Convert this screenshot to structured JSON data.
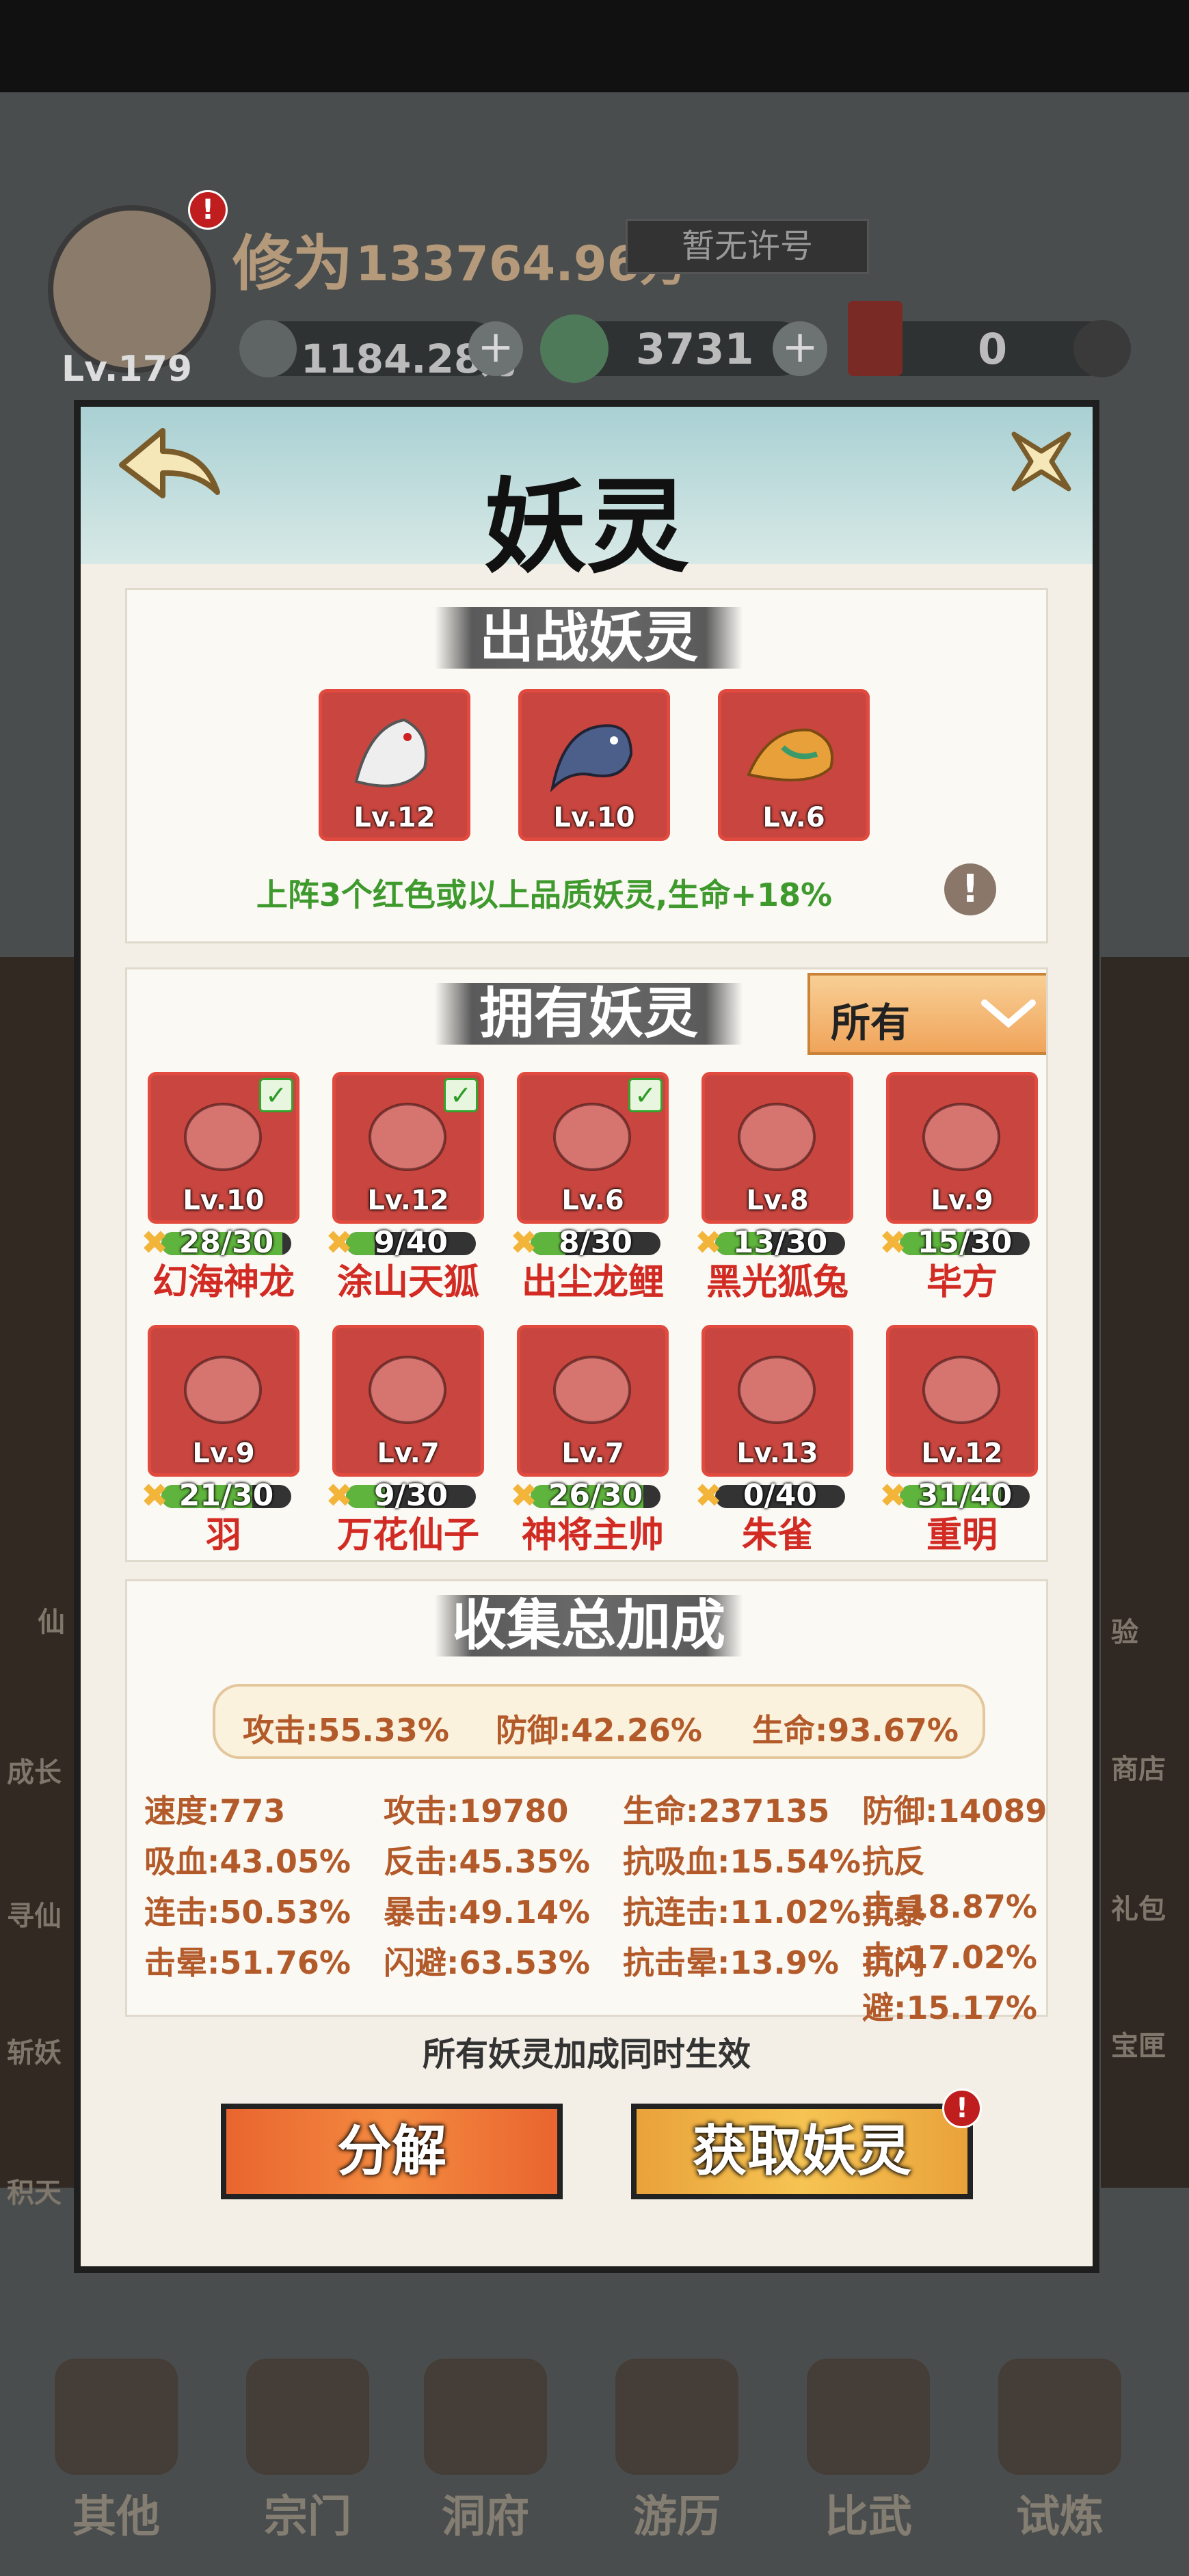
{
  "background": {
    "player": {
      "cultivation_label": "修为",
      "cultivation_value": "133764.96万",
      "title_badge": "暂无许号",
      "level": "Lv.179"
    },
    "resources": [
      {
        "icon": "spirit-stone-icon",
        "value": "1184.28万"
      },
      {
        "icon": "jade-icon",
        "value": "3731"
      },
      {
        "icon": "red-envelope-icon",
        "value": "0"
      }
    ],
    "side_left": [
      "仙",
      "成长",
      "寻仙",
      "斩妖",
      "积天"
    ],
    "side_right": [
      "验",
      "商店",
      "礼包",
      "宝匣"
    ],
    "nav": [
      {
        "label": "其他",
        "icon": "bag-icon"
      },
      {
        "label": "宗门",
        "icon": "gate-icon"
      },
      {
        "label": "洞府",
        "icon": "pavilion-icon"
      },
      {
        "label": "游历",
        "icon": "mountain-icon"
      },
      {
        "label": "比武",
        "icon": "swords-icon"
      },
      {
        "label": "试炼",
        "icon": "scroll-icon"
      }
    ]
  },
  "modal": {
    "title": "妖灵",
    "battle": {
      "title": "出战妖灵",
      "slots": [
        {
          "level": "Lv.12",
          "art": "fox-art-icon"
        },
        {
          "level": "Lv.10",
          "art": "dragon-art-icon"
        },
        {
          "level": "Lv.6",
          "art": "carp-art-icon"
        }
      ],
      "bonus_text": "上阵3个红色或以上品质妖灵,生命+18%"
    },
    "owned": {
      "title": "拥有妖灵",
      "filter": "所有",
      "pets": [
        {
          "name": "幻海神龙",
          "level": "Lv.10",
          "frag": "28/30",
          "progress": 0.93,
          "equipped": true
        },
        {
          "name": "涂山天狐",
          "level": "Lv.12",
          "frag": "9/40",
          "progress": 0.22,
          "equipped": true
        },
        {
          "name": "出尘龙鲤",
          "level": "Lv.6",
          "frag": "8/30",
          "progress": 0.27,
          "equipped": true
        },
        {
          "name": "黑光狐兔",
          "level": "Lv.8",
          "frag": "13/30",
          "progress": 0.43,
          "equipped": false
        },
        {
          "name": "毕方",
          "level": "Lv.9",
          "frag": "15/30",
          "progress": 0.5,
          "equipped": false
        },
        {
          "name": "羽",
          "level": "Lv.9",
          "frag": "21/30",
          "progress": 0.7,
          "equipped": false
        },
        {
          "name": "万花仙子",
          "level": "Lv.7",
          "frag": "9/30",
          "progress": 0.3,
          "equipped": false
        },
        {
          "name": "神将主帅",
          "level": "Lv.7",
          "frag": "26/30",
          "progress": 0.87,
          "equipped": false
        },
        {
          "name": "朱雀",
          "level": "Lv.13",
          "frag": "0/40",
          "progress": 0.0,
          "equipped": false
        },
        {
          "name": "重明",
          "level": "Lv.12",
          "frag": "31/40",
          "progress": 0.78,
          "equipped": false
        }
      ]
    },
    "collection": {
      "title": "收集总加成",
      "summary": [
        "攻击:55.33%",
        "防御:42.26%",
        "生命:93.67%"
      ],
      "stats": [
        [
          "速度:773",
          "攻击:19780",
          "生命:237135",
          "防御:14089"
        ],
        [
          "吸血:43.05%",
          "反击:45.35%",
          "抗吸血:15.54%",
          "抗反击:18.87%"
        ],
        [
          "连击:50.53%",
          "暴击:49.14%",
          "抗连击:11.02%",
          "抗暴击:17.02%"
        ],
        [
          "击晕:51.76%",
          "闪避:63.53%",
          "抗击晕:13.9%",
          "抗闪避:15.17%"
        ]
      ],
      "note": "所有妖灵加成同时生效"
    },
    "buttons": {
      "decompose": "分解",
      "obtain": "获取妖灵"
    }
  }
}
